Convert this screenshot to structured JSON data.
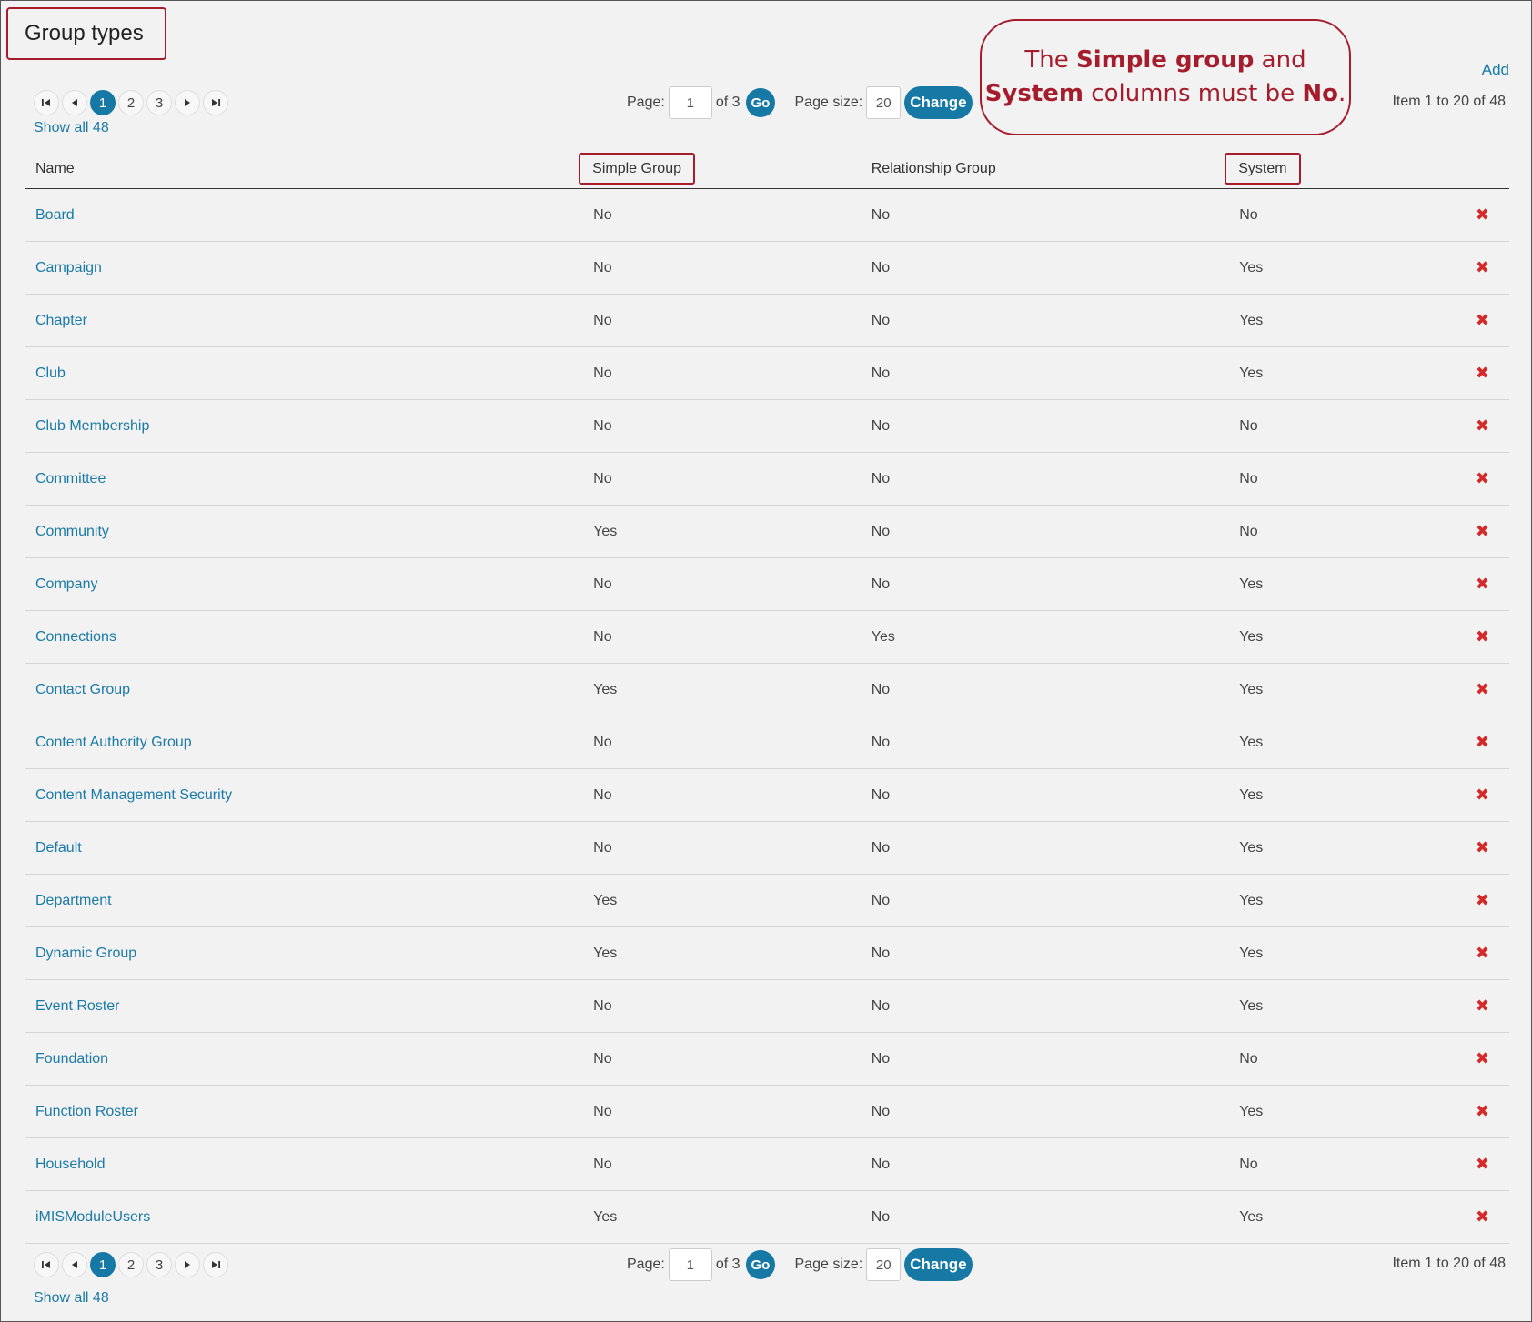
{
  "page_title": "Group types",
  "add_label": "Add",
  "callout": {
    "prefix": "The ",
    "bold1": "Simple group",
    "middle": " and",
    "bold2": "System",
    "middle2": " columns must be ",
    "bold3": "No",
    "suffix": "."
  },
  "pager": {
    "pages": [
      "1",
      "2",
      "3"
    ],
    "page_label": "Page:",
    "page_value": "1",
    "of_text": "of 3",
    "go_label": "Go",
    "size_label": "Page size:",
    "size_value": "20",
    "change_label": "Change",
    "count_text": "Item 1 to 20 of 48",
    "show_all": "Show all 48"
  },
  "table": {
    "headers": [
      "Name",
      "Simple Group",
      "Relationship Group",
      "System"
    ],
    "rows": [
      [
        "Board",
        "No",
        "No",
        "No"
      ],
      [
        "Campaign",
        "No",
        "No",
        "Yes"
      ],
      [
        "Chapter",
        "No",
        "No",
        "Yes"
      ],
      [
        "Club",
        "No",
        "No",
        "Yes"
      ],
      [
        "Club Membership",
        "No",
        "No",
        "No"
      ],
      [
        "Committee",
        "No",
        "No",
        "No"
      ],
      [
        "Community",
        "Yes",
        "No",
        "No"
      ],
      [
        "Company",
        "No",
        "No",
        "Yes"
      ],
      [
        "Connections",
        "No",
        "Yes",
        "Yes"
      ],
      [
        "Contact Group",
        "Yes",
        "No",
        "Yes"
      ],
      [
        "Content Authority Group",
        "No",
        "No",
        "Yes"
      ],
      [
        "Content Management Security",
        "No",
        "No",
        "Yes"
      ],
      [
        "Default",
        "No",
        "No",
        "Yes"
      ],
      [
        "Department",
        "Yes",
        "No",
        "Yes"
      ],
      [
        "Dynamic Group",
        "Yes",
        "No",
        "Yes"
      ],
      [
        "Event Roster",
        "No",
        "No",
        "Yes"
      ],
      [
        "Foundation",
        "No",
        "No",
        "No"
      ],
      [
        "Function Roster",
        "No",
        "No",
        "Yes"
      ],
      [
        "Household",
        "No",
        "No",
        "No"
      ],
      [
        "iMISModuleUsers",
        "Yes",
        "No",
        "Yes"
      ]
    ],
    "delete_glyph": "✖"
  },
  "colors": {
    "accent": "#1678a5",
    "highlight": "#a51d2d",
    "delete": "#d42a2a"
  }
}
